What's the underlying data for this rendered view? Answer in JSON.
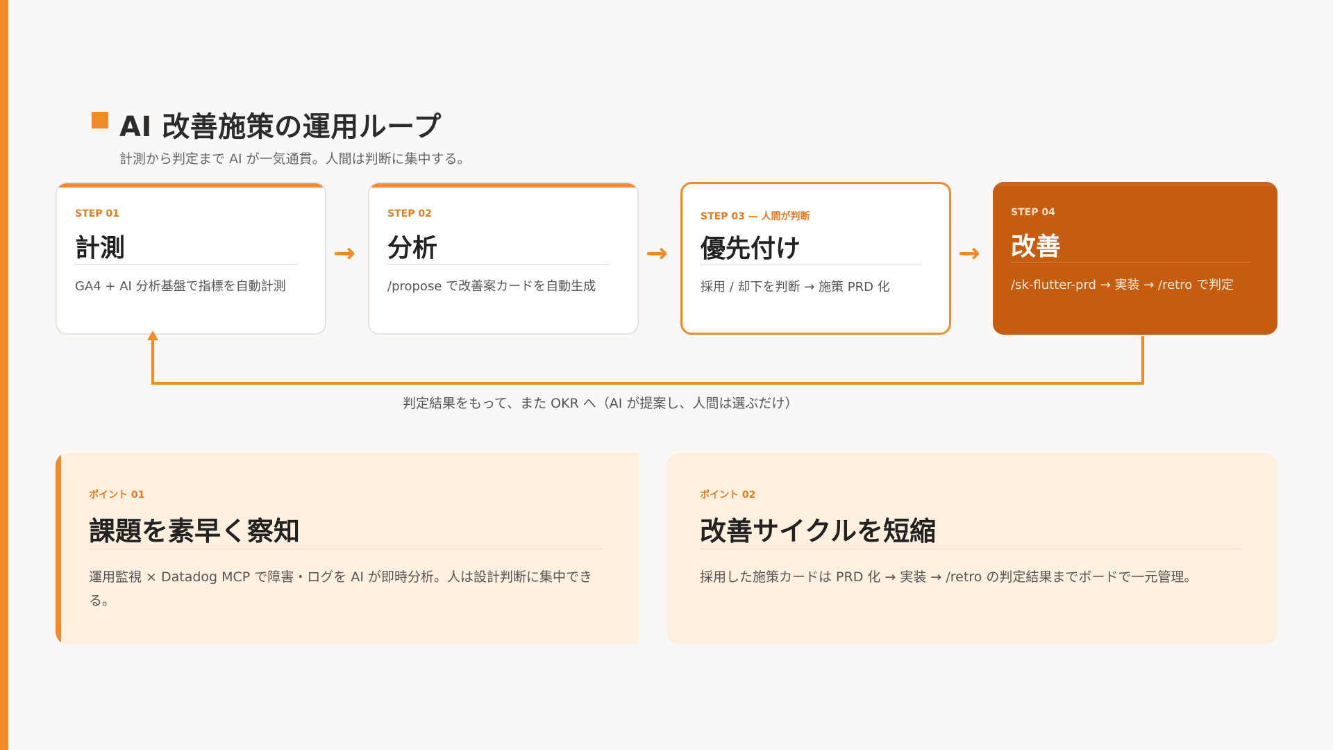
{
  "header": {
    "title": "AI 改善施策の運用ループ",
    "subtitle": "計測から判定まで AI が一気通貫。人間は判断に集中する。"
  },
  "steps": [
    {
      "label": "STEP 01",
      "title": "計測",
      "desc": "GA4 + AI 分析基盤で指標を自動計測"
    },
    {
      "label": "STEP 02",
      "title": "分析",
      "desc": "/propose で改善案カードを自動生成"
    },
    {
      "label": "STEP 03 — 人間が判断",
      "title": "優先付け",
      "desc": "採用 / 却下を判断 → 施策 PRD 化"
    },
    {
      "label": "STEP 04",
      "title": "改善",
      "desc": "/sk-flutter-prd → 実装 → /retro で判定"
    }
  ],
  "arrow_glyph": "→",
  "loop": {
    "caption": "判定結果をもって、また OKR へ（AI が提案し、人間は選ぶだけ）"
  },
  "points": [
    {
      "label": "ポイント 01",
      "title": "課題を素早く察知",
      "desc": "運用監視 × Datadog MCP で障害・ログを AI が即時分析。人は設計判断に集中できる。"
    },
    {
      "label": "ポイント 02",
      "title": "改善サイクルを短縮",
      "desc": "採用した施策カードは PRD 化 → 実装 → /retro の判定結果までボードで一元管理。"
    }
  ],
  "colors": {
    "accent": "#f38a2a",
    "step4_fill": "#c65c10",
    "point_bg": "#fdf0de",
    "page_bg": "#f9f8f6"
  }
}
